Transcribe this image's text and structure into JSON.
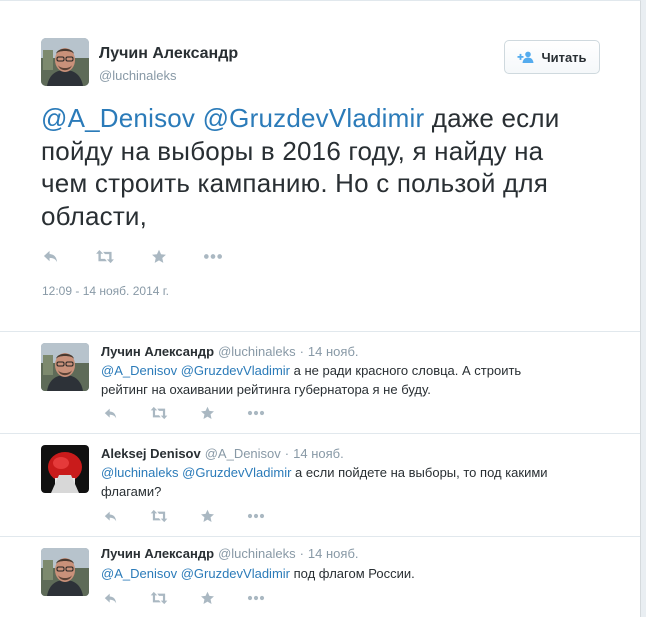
{
  "main_tweet": {
    "author_name": "Лучин Александр",
    "author_handle": "@luchinaleks",
    "follow_button": "Читать",
    "text_mentions": [
      "@A_Denisov",
      "@GruzdevVladimir"
    ],
    "text_body": " даже если пойду на выборы в 2016 году, я найду на чем строить кампанию. Но с пользой для области,",
    "timestamp": "12:09 - 14 нояб. 2014 г.",
    "actions": [
      "reply-icon",
      "retweet-icon",
      "favorite-icon",
      "more-icon"
    ]
  },
  "replies": [
    {
      "author_name": "Лучин Александр",
      "author_handle": "@luchinaleks",
      "separator": "·",
      "time": "14 нояб.",
      "mentions": [
        "@A_Denisov",
        "@GruzdevVladimir"
      ],
      "text": " а не ради красного словца. А строить рейтинг на охаивании рейтинга губернатора я не буду."
    },
    {
      "author_name": "Aleksej Denisov",
      "author_handle": "@A_Denisov",
      "separator": "·",
      "time": "14 нояб.",
      "mentions": [
        "@luchinaleks",
        "@GruzdevVladimir"
      ],
      "text": " а если пойдете на выборы, то под какими флагами?"
    },
    {
      "author_name": "Лучин Александр",
      "author_handle": "@luchinaleks",
      "separator": "·",
      "time": "14 нояб.",
      "mentions": [
        "@A_Denisov",
        "@GruzdevVladimir"
      ],
      "text": " под флагом России."
    }
  ],
  "colors": {
    "link": "#2b7bb9",
    "text": "#292f33",
    "muted": "#8899a6",
    "icon": "#aab8c2",
    "follow_icon": "#55acee"
  }
}
